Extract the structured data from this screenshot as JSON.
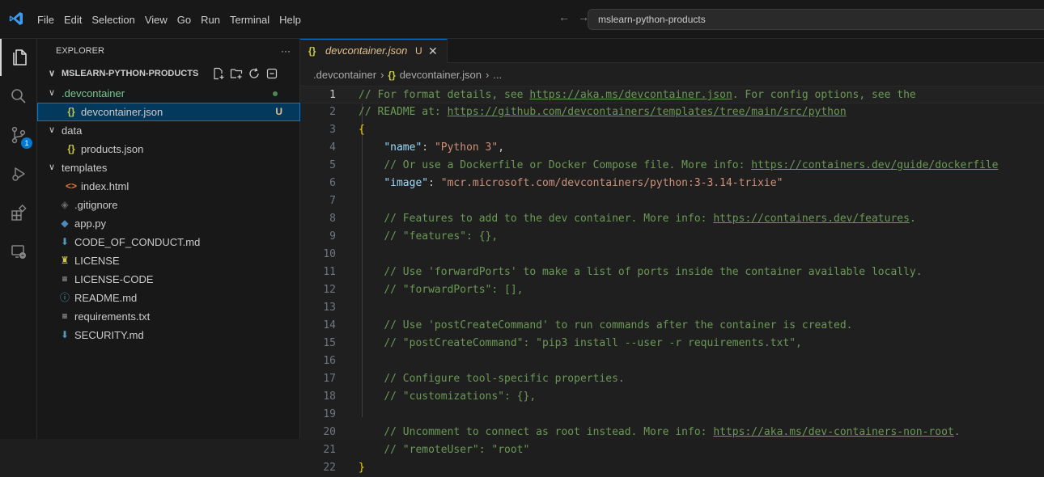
{
  "menu": [
    "File",
    "Edit",
    "Selection",
    "View",
    "Go",
    "Run",
    "Terminal",
    "Help"
  ],
  "command_center": {
    "text": "mslearn-python-products"
  },
  "activity_bar": {
    "items": [
      {
        "name": "explorer-icon",
        "active": true
      },
      {
        "name": "search-icon"
      },
      {
        "name": "source-control-icon",
        "badge": "1"
      },
      {
        "name": "run-debug-icon"
      },
      {
        "name": "extensions-icon"
      },
      {
        "name": "remote-explorer-icon"
      }
    ]
  },
  "sidebar": {
    "title": "EXPLORER",
    "more": "···",
    "section_title": "MSLEARN-PYTHON-PRODUCTS",
    "tree": [
      {
        "label": ".devcontainer",
        "type": "folder",
        "depth": 1,
        "open": true,
        "git": "modified-dot"
      },
      {
        "label": "devcontainer.json",
        "type": "json",
        "depth": 2,
        "selected": true,
        "status": "U"
      },
      {
        "label": "data",
        "type": "folder",
        "depth": 1,
        "open": true
      },
      {
        "label": "products.json",
        "type": "json",
        "depth": 2
      },
      {
        "label": "templates",
        "type": "folder",
        "depth": 1,
        "open": true
      },
      {
        "label": "index.html",
        "type": "html",
        "depth": 2
      },
      {
        "label": ".gitignore",
        "type": "gitignore",
        "depth": 1
      },
      {
        "label": "app.py",
        "type": "python",
        "depth": 1
      },
      {
        "label": "CODE_OF_CONDUCT.md",
        "type": "md-down",
        "depth": 1
      },
      {
        "label": "LICENSE",
        "type": "license",
        "depth": 1
      },
      {
        "label": "LICENSE-CODE",
        "type": "text",
        "depth": 1
      },
      {
        "label": "README.md",
        "type": "info",
        "depth": 1
      },
      {
        "label": "requirements.txt",
        "type": "text",
        "depth": 1
      },
      {
        "label": "SECURITY.md",
        "type": "md-down",
        "depth": 1
      }
    ]
  },
  "editor": {
    "tab": {
      "icon": "{}",
      "name": "devcontainer.json",
      "badge": "U",
      "close": "✕"
    },
    "breadcrumb": [
      ".devcontainer",
      "devcontainer.json",
      "..."
    ],
    "current_line": 1,
    "lines": [
      [
        [
          "c",
          "// For format details, see "
        ],
        [
          "u",
          "https://aka.ms/devcontainer.json"
        ],
        [
          "c",
          ". For config options, see the"
        ]
      ],
      [
        [
          "c",
          "// README at: "
        ],
        [
          "u",
          "https://github.com/devcontainers/templates/tree/main/src/python"
        ]
      ],
      [
        [
          "b",
          "{"
        ]
      ],
      [
        [
          "p",
          "\t"
        ],
        [
          "k",
          "\"name\""
        ],
        [
          "p",
          ": "
        ],
        [
          "s",
          "\"Python 3\""
        ],
        [
          "p",
          ","
        ]
      ],
      [
        [
          "p",
          "\t"
        ],
        [
          "c",
          "// Or use a Dockerfile or Docker Compose file. More info: "
        ],
        [
          "u",
          "https://containers.dev/guide/dockerfile"
        ]
      ],
      [
        [
          "p",
          "\t"
        ],
        [
          "k",
          "\"image\""
        ],
        [
          "p",
          ": "
        ],
        [
          "s",
          "\"mcr.microsoft.com/devcontainers/python:3-3.14-trixie\""
        ]
      ],
      [],
      [
        [
          "p",
          "\t"
        ],
        [
          "c",
          "// Features to add to the dev container. More info: "
        ],
        [
          "u",
          "https://containers.dev/features"
        ],
        [
          "c",
          "."
        ]
      ],
      [
        [
          "p",
          "\t"
        ],
        [
          "c",
          "// \"features\": {},"
        ]
      ],
      [],
      [
        [
          "p",
          "\t"
        ],
        [
          "c",
          "// Use 'forwardPorts' to make a list of ports inside the container available locally."
        ]
      ],
      [
        [
          "p",
          "\t"
        ],
        [
          "c",
          "// \"forwardPorts\": [],"
        ]
      ],
      [],
      [
        [
          "p",
          "\t"
        ],
        [
          "c",
          "// Use 'postCreateCommand' to run commands after the container is created."
        ]
      ],
      [
        [
          "p",
          "\t"
        ],
        [
          "c",
          "// \"postCreateCommand\": \"pip3 install --user -r requirements.txt\","
        ]
      ],
      [],
      [
        [
          "p",
          "\t"
        ],
        [
          "c",
          "// Configure tool-specific properties."
        ]
      ],
      [
        [
          "p",
          "\t"
        ],
        [
          "c",
          "// \"customizations\": {},"
        ]
      ],
      [],
      [
        [
          "p",
          "\t"
        ],
        [
          "c",
          "// Uncomment to connect as root instead. More info: "
        ],
        [
          "u",
          "https://aka.ms/dev-containers-non-root"
        ],
        [
          "c",
          "."
        ]
      ],
      [
        [
          "p",
          "\t"
        ],
        [
          "c",
          "// \"remoteUser\": \"root\""
        ]
      ],
      [
        [
          "b",
          "}"
        ]
      ]
    ]
  }
}
